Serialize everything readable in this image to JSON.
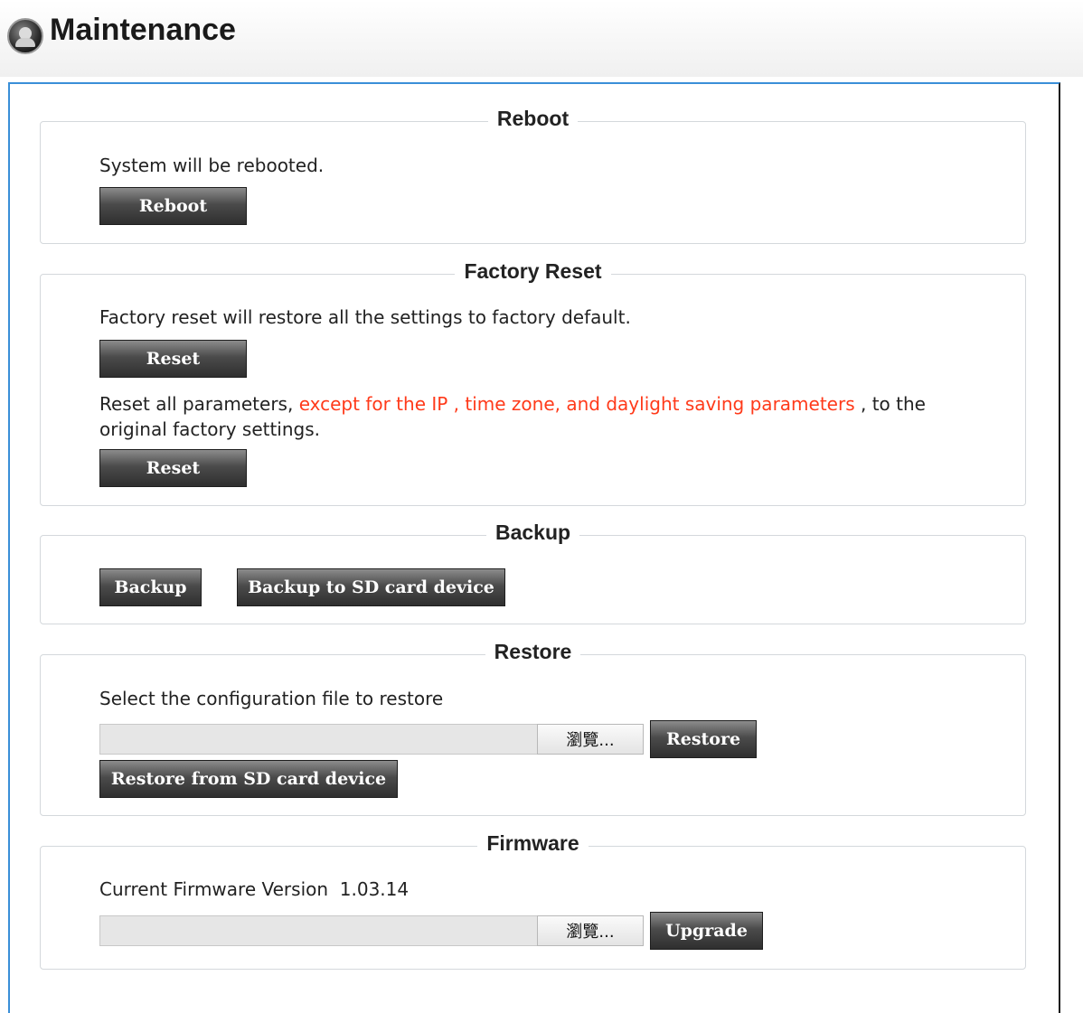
{
  "page": {
    "title": "Maintenance",
    "icon": "user-icon"
  },
  "reboot": {
    "legend": "Reboot",
    "description": "System will be rebooted.",
    "button_label": "Reboot"
  },
  "factory_reset": {
    "legend": "Factory Reset",
    "description": "Factory reset will restore all the settings to factory default.",
    "reset_button_label": "Reset",
    "partial_text_before": "Reset all parameters, ",
    "partial_text_highlight": "except for the IP , time zone, and daylight saving parameters",
    "partial_text_after": " , to the",
    "partial_text_line2": "original factory settings.",
    "partial_reset_button_label": "Reset",
    "highlight_color": "#ff3a1a"
  },
  "backup": {
    "legend": "Backup",
    "backup_button_label": "Backup",
    "backup_sd_button_label": "Backup to SD card device"
  },
  "restore": {
    "legend": "Restore",
    "description": "Select the configuration file to restore",
    "file_value": "",
    "browse_label": "瀏覽...",
    "restore_button_label": "Restore",
    "restore_sd_button_label": "Restore from SD card device"
  },
  "firmware": {
    "legend": "Firmware",
    "version_label": "Current Firmware Version",
    "version_value": "1.03.14",
    "file_value": "",
    "browse_label": "瀏覽...",
    "upgrade_button_label": "Upgrade"
  },
  "colors": {
    "frame_accent": "#3a8fd8",
    "button_dark": "#2f2f2f"
  }
}
